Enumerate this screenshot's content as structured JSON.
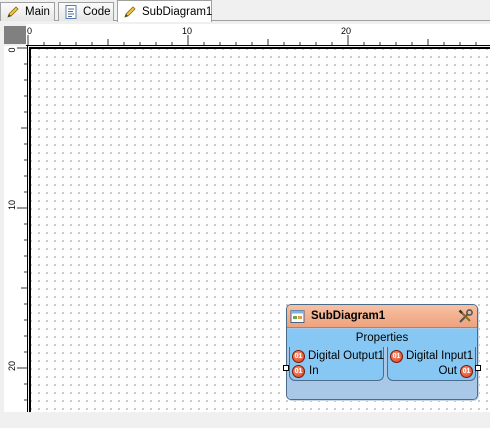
{
  "tabs": [
    {
      "label": "Main",
      "icon": "pencil-icon",
      "active": false
    },
    {
      "label": "Code",
      "icon": "code-file-icon",
      "active": false
    },
    {
      "label": "SubDiagram1",
      "icon": "pencil-icon",
      "active": true
    }
  ],
  "ruler": {
    "horizontal_labels": [
      "0",
      "10",
      "20"
    ],
    "vertical_labels": [
      "0",
      "10",
      "20"
    ]
  },
  "block": {
    "title": "SubDiagram1",
    "properties_label": "Properties",
    "ports_left": {
      "name": "Digital Output1",
      "pin": "In"
    },
    "ports_right": {
      "name": "Digital Input1",
      "pin": "Out"
    }
  },
  "colors": {
    "header": "#eea37e",
    "body": "#86c8f3",
    "frame": "#a9c7e6"
  }
}
